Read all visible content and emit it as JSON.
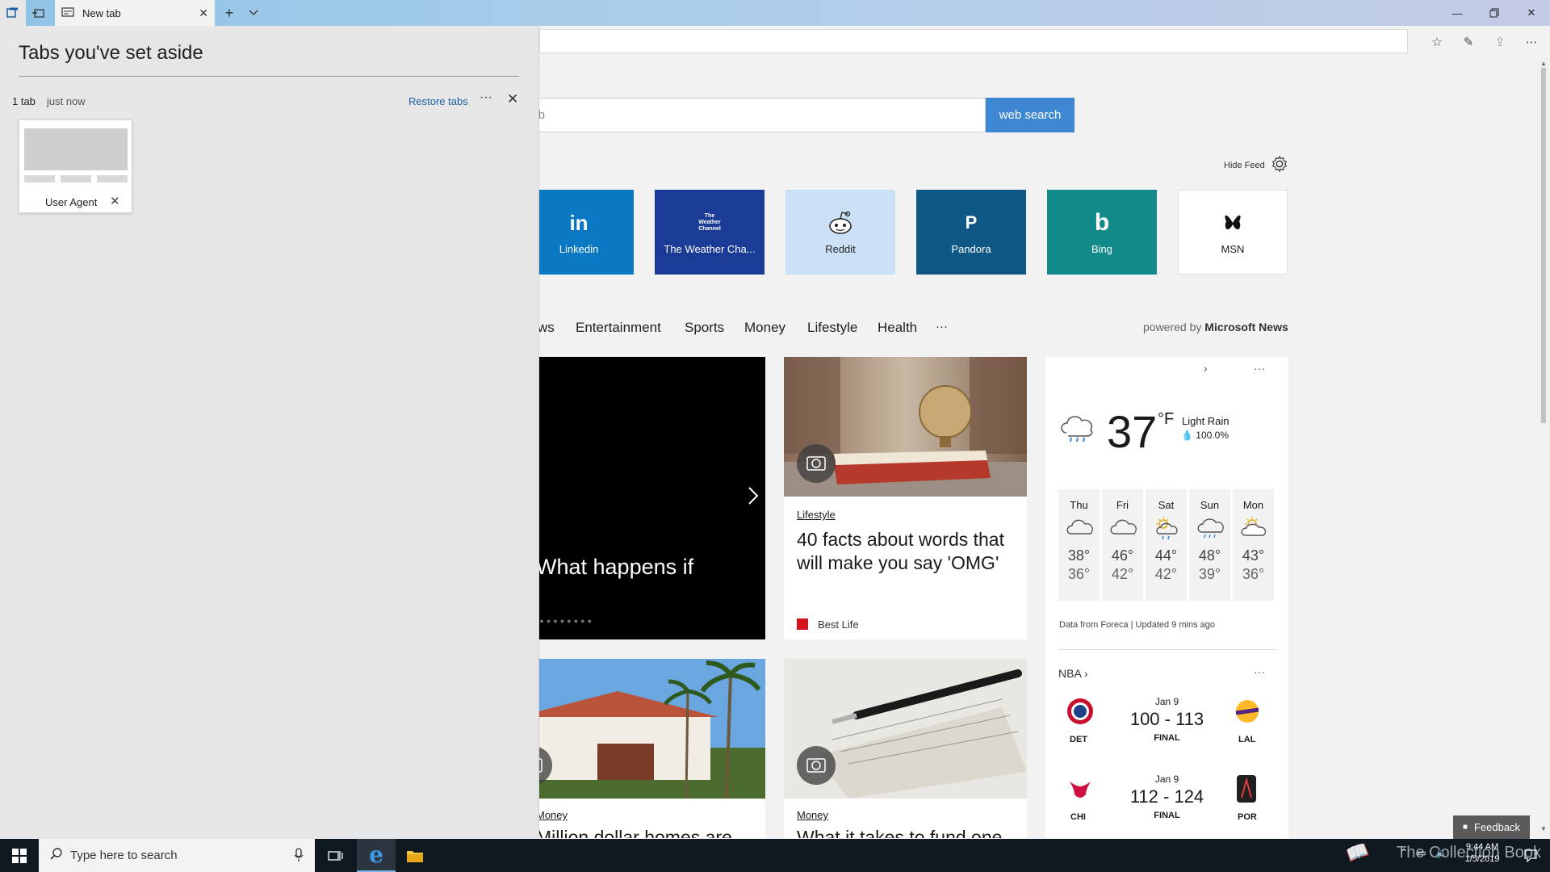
{
  "browser": {
    "tab_title": "New tab",
    "search_partial_placeholder": "e web",
    "search_button": "web search",
    "hide_feed": "Hide Feed"
  },
  "panel": {
    "title": "Tabs you've set aside",
    "group_count": "1 tab",
    "group_time": "just now",
    "restore_label": "Restore tabs",
    "more_label": "···",
    "tab_label": "User Agent"
  },
  "tiles": [
    {
      "label": "Linkedin",
      "logo": "in",
      "color": "#0a78c3"
    },
    {
      "label": "The Weather Cha...",
      "logo": "The Weather Channel",
      "color": "#1b3c96"
    },
    {
      "label": "Reddit",
      "logo": "reddit-alien",
      "color": "#c9e0f5"
    },
    {
      "label": "Pandora",
      "logo": "P",
      "color": "#0f5784"
    },
    {
      "label": "Bing",
      "logo": "b",
      "color": "#138a8a"
    },
    {
      "label": "MSN",
      "logo": "msn-butterfly",
      "color": "#ffffff"
    }
  ],
  "categories": [
    "ws",
    "Entertainment",
    "Sports",
    "Money",
    "Lifestyle",
    "Health",
    "···"
  ],
  "powered_by": {
    "prefix": "powered by",
    "brand": "Microsoft News"
  },
  "hero": {
    "headline": "What happens if"
  },
  "articles": [
    {
      "category": "Lifestyle",
      "title_line1": "40 facts about words that",
      "title_line2": "will make you say 'OMG'",
      "source": "Best Life"
    },
    {
      "category": "Money",
      "title": "Million dollar homes are"
    },
    {
      "category": "Money",
      "title": "What it takes to fund one"
    }
  ],
  "weather": {
    "temp": "37",
    "unit": "°F",
    "condition": "Light Rain",
    "precip": "100.0%",
    "forecast": [
      {
        "day": "Thu",
        "hi": "38°",
        "lo": "36°",
        "icon": "cloud"
      },
      {
        "day": "Fri",
        "hi": "46°",
        "lo": "42°",
        "icon": "cloud"
      },
      {
        "day": "Sat",
        "hi": "44°",
        "lo": "42°",
        "icon": "sun-rain"
      },
      {
        "day": "Sun",
        "hi": "48°",
        "lo": "39°",
        "icon": "rain"
      },
      {
        "day": "Mon",
        "hi": "43°",
        "lo": "36°",
        "icon": "partly-cloudy"
      }
    ],
    "footer": "Data from Foreca | Updated 9 mins ago"
  },
  "nba": {
    "title": "NBA",
    "games": [
      {
        "date": "Jan 9",
        "score": "100 - 113",
        "status": "FINAL",
        "home": "DET",
        "away": "LAL"
      },
      {
        "date": "Jan 9",
        "score": "112 - 124",
        "status": "FINAL",
        "home": "CHI",
        "away": "POR"
      }
    ]
  },
  "taskbar": {
    "search_placeholder": "Type here to search",
    "time": "9:44 AM",
    "date": "1/5/2019",
    "watermark": "The Collection Book",
    "feedback": "Feedback"
  }
}
